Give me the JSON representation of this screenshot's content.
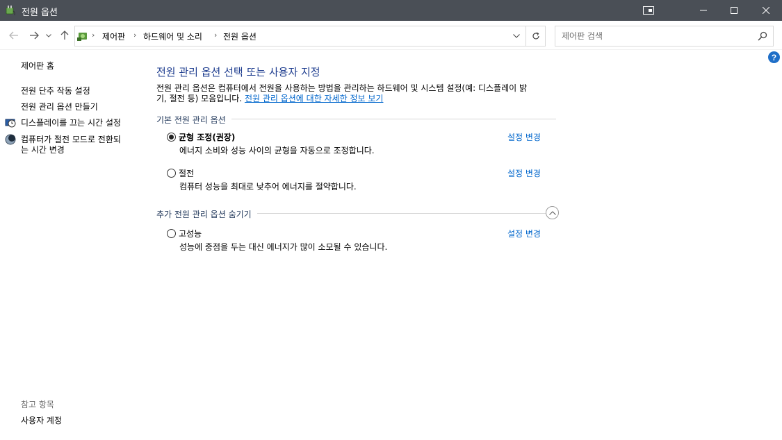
{
  "window": {
    "title": "전원 옵션"
  },
  "address": {
    "crumbs": [
      "제어판",
      "하드웨어 및 소리",
      "전원 옵션"
    ]
  },
  "search": {
    "placeholder": "제어판 검색"
  },
  "sidebar": {
    "home": "제어판 홈",
    "links": [
      "전원 단추 작동 설정",
      "전원 관리 옵션 만들기",
      "디스플레이를 끄는 시간 설정",
      "컴퓨터가 절전 모드로 전환되",
      "는 시간 변경"
    ],
    "see_also_heading": "참고 항목",
    "see_also_links": [
      "사용자 계정"
    ]
  },
  "main": {
    "title": "전원 관리 옵션 선택 또는 사용자 지정",
    "description_line1": "전원 관리 옵션은 컴퓨터에서 전원을 사용하는 방법을 관리하는 하드웨어 및 시스템 설정(예: 디스플레이 밝",
    "description_line2_prefix": "기, 절전 등) 모음입니다. ",
    "description_link": "전원 관리 옵션에 대한 자세한 정보 보기",
    "basic_section_title": "기본 전원 관리 옵션",
    "extra_section_title": "추가 전원 관리 옵션 숨기기",
    "change_settings_label": "설정 변경",
    "plans": [
      {
        "name": "균형 조정(권장)",
        "desc": "에너지 소비와 성능 사이의 균형을 자동으로 조정합니다.",
        "selected": true
      },
      {
        "name": "절전",
        "desc": "컴퓨터 성능을 최대로 낮추어 에너지를 절약합니다.",
        "selected": false
      },
      {
        "name": "고성능",
        "desc": "성능에 중점을 두는 대신 에너지가 많이 소모될 수 있습니다.",
        "selected": false
      }
    ]
  },
  "icons": {
    "app": "power-options-icon",
    "help": "?",
    "accent_color": "#1e3d8f",
    "link_color": "#0066cc",
    "titlebar_color": "#4a4f56"
  }
}
